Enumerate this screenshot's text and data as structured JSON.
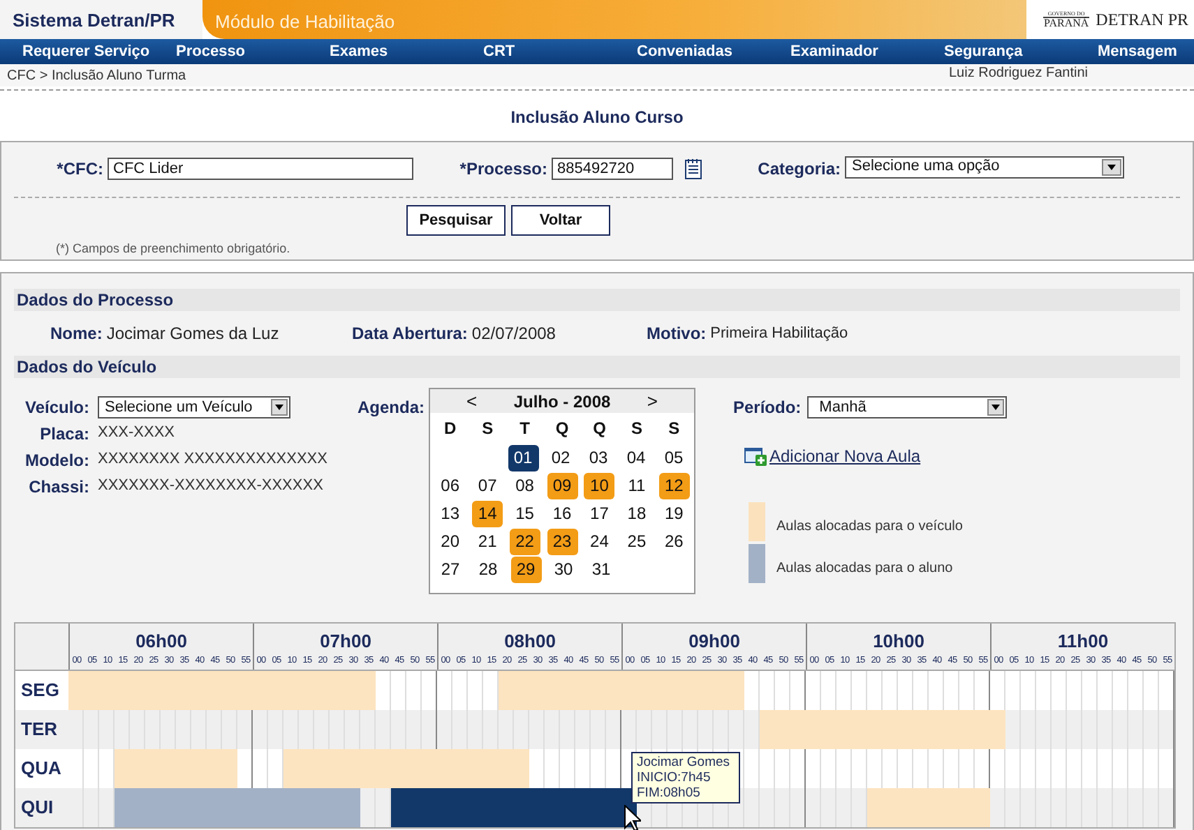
{
  "header": {
    "system_title": "Sistema Detran/PR",
    "module_title": "Módulo de Habilitação",
    "logo_top": "GOVERNO DO",
    "logo_bottom": "PARANÁ",
    "logo_right": "DETRAN PR"
  },
  "menu": [
    "Requerer Serviço",
    "Processo",
    "Exames",
    "CRT",
    "Conveniadas",
    "Examinador",
    "Segurança",
    "Mensagem"
  ],
  "breadcrumb": "CFC > Inclusão Aluno Turma",
  "user": "Luiz Rodriguez Fantini",
  "page_title": "Inclusão Aluno Curso",
  "search_form": {
    "cfc": {
      "label": "*CFC:",
      "value": "CFC Lider"
    },
    "processo": {
      "label": "*Processo:",
      "value": "885492720"
    },
    "categoria": {
      "label": "Categoria:",
      "value": "Selecione uma opção"
    },
    "buttons": [
      "Pesquisar",
      "Voltar"
    ],
    "note": "(*) Campos de preenchimento obrigatório."
  },
  "process_data": {
    "title": "Dados do Processo",
    "fields": [
      {
        "label": "Nome:",
        "value": "Jocimar Gomes da Luz"
      },
      {
        "label": "Data Abertura:",
        "value": "02/07/2008"
      },
      {
        "label": "Motivo:",
        "value": "Primeira Habilitação"
      }
    ]
  },
  "vehicle_data": {
    "title": "Dados do Veículo",
    "vehicle": {
      "label": "Veículo:",
      "value": "Selecione um Veículo"
    },
    "details": [
      {
        "label": "Placa:",
        "value": "XXX-XXXX"
      },
      {
        "label": "Modelo:",
        "value": "XXXXXXXX XXXXXXXXXXXXXX"
      },
      {
        "label": "Chassi:",
        "value": "XXXXXXX-XXXXXXXX-XXXXXX"
      }
    ],
    "agenda_label": "Agenda:",
    "period": {
      "label": "Período:",
      "value": "Manhã"
    },
    "add_link": "Adicionar Nova Aula",
    "legend": [
      {
        "label": "Aulas alocadas para o veículo",
        "color": "#fbe2bd"
      },
      {
        "label": "Aulas alocadas para o aluno",
        "color": "#a2b1c6"
      }
    ]
  },
  "calendar": {
    "prev": "<",
    "title": "Julho - 2008",
    "next": ">",
    "weekdays": [
      "D",
      "S",
      "T",
      "Q",
      "Q",
      "S",
      "S"
    ],
    "weeks": [
      {
        "days": [
          {
            "day": "01",
            "selected": true,
            "scheduled": false
          },
          {
            "day": "02",
            "selected": false,
            "scheduled": false
          },
          {
            "day": "03",
            "selected": false,
            "scheduled": false
          },
          {
            "day": "04",
            "selected": false,
            "scheduled": false
          },
          {
            "day": "05",
            "selected": false,
            "scheduled": false
          }
        ]
      },
      {
        "days": [
          {
            "day": "06",
            "selected": false,
            "scheduled": false
          },
          {
            "day": "07",
            "selected": false,
            "scheduled": false
          },
          {
            "day": "08",
            "selected": false,
            "scheduled": false
          },
          {
            "day": "09",
            "selected": false,
            "scheduled": true
          },
          {
            "day": "10",
            "selected": false,
            "scheduled": true
          },
          {
            "day": "11",
            "selected": false,
            "scheduled": false
          },
          {
            "day": "12",
            "selected": false,
            "scheduled": true
          }
        ]
      },
      {
        "days": [
          {
            "day": "13",
            "selected": false,
            "scheduled": false
          },
          {
            "day": "14",
            "selected": false,
            "scheduled": true
          },
          {
            "day": "15",
            "selected": false,
            "scheduled": false
          },
          {
            "day": "16",
            "selected": false,
            "scheduled": false
          },
          {
            "day": "17",
            "selected": false,
            "scheduled": false
          },
          {
            "day": "18",
            "selected": false,
            "scheduled": false
          },
          {
            "day": "19",
            "selected": false,
            "scheduled": false
          }
        ]
      },
      {
        "days": [
          {
            "day": "20",
            "selected": false,
            "scheduled": false
          },
          {
            "day": "21",
            "selected": false,
            "scheduled": false
          },
          {
            "day": "22",
            "selected": false,
            "scheduled": true
          },
          {
            "day": "23",
            "selected": false,
            "scheduled": true
          },
          {
            "day": "24",
            "selected": false,
            "scheduled": false
          },
          {
            "day": "25",
            "selected": false,
            "scheduled": false
          },
          {
            "day": "26",
            "selected": false,
            "scheduled": false
          }
        ]
      },
      {
        "days": [
          {
            "day": "27",
            "selected": false,
            "scheduled": false
          },
          {
            "day": "28",
            "selected": false,
            "scheduled": false
          },
          {
            "day": "29",
            "selected": false,
            "scheduled": true
          },
          {
            "day": "30",
            "selected": false,
            "scheduled": false
          },
          {
            "day": "31",
            "selected": false,
            "scheduled": false
          }
        ]
      }
    ]
  },
  "schedule": {
    "hours": [
      {
        "label": "06h00",
        "minutes": [
          "00",
          "05",
          "10",
          "15",
          "20",
          "25",
          "30",
          "35",
          "40",
          "45",
          "50",
          "55"
        ]
      },
      {
        "label": "07h00",
        "minutes": [
          "00",
          "05",
          "10",
          "15",
          "20",
          "25",
          "30",
          "35",
          "40",
          "45",
          "50",
          "55"
        ]
      },
      {
        "label": "08h00",
        "minutes": [
          "00",
          "05",
          "10",
          "15",
          "20",
          "25",
          "30",
          "35",
          "40",
          "45",
          "50",
          "55"
        ]
      },
      {
        "label": "09h00",
        "minutes": [
          "00",
          "05",
          "10",
          "15",
          "20",
          "25",
          "30",
          "35",
          "40",
          "45",
          "50",
          "55"
        ]
      },
      {
        "label": "10h00",
        "minutes": [
          "00",
          "05",
          "10",
          "15",
          "20",
          "25",
          "30",
          "35",
          "40",
          "45",
          "50",
          "55"
        ]
      },
      {
        "label": "11h00",
        "minutes": [
          "00",
          "05",
          "10",
          "15",
          "20",
          "25",
          "30",
          "35",
          "40",
          "45",
          "50",
          "55"
        ]
      }
    ],
    "rows": [
      {
        "day": "SEG",
        "slots": [
          {
            "kind": "vehicle"
          },
          {
            "kind": "vehicle"
          },
          {
            "kind": "vehicle"
          },
          {
            "kind": "vehicle"
          },
          {
            "kind": "vehicle"
          },
          {
            "kind": "vehicle"
          },
          {
            "kind": "vehicle"
          },
          {
            "kind": "vehicle"
          },
          {
            "kind": "vehicle"
          },
          {
            "kind": "vehicle"
          },
          {
            "kind": "vehicle"
          },
          {
            "kind": "vehicle"
          },
          {
            "kind": "vehicle"
          },
          {
            "kind": "vehicle"
          },
          {
            "kind": "vehicle"
          },
          {
            "kind": "vehicle"
          },
          {
            "kind": "vehicle"
          },
          {
            "kind": "vehicle"
          },
          {
            "kind": "vehicle"
          },
          {
            "kind": "vehicle"
          },
          {
            "kind": "free"
          },
          {
            "kind": "free"
          },
          {
            "kind": "free"
          },
          {
            "kind": "free"
          },
          {
            "kind": "free"
          },
          {
            "kind": "free"
          },
          {
            "kind": "free"
          },
          {
            "kind": "free"
          },
          {
            "kind": "vehicle"
          },
          {
            "kind": "vehicle"
          },
          {
            "kind": "vehicle"
          },
          {
            "kind": "vehicle"
          },
          {
            "kind": "vehicle"
          },
          {
            "kind": "vehicle"
          },
          {
            "kind": "vehicle"
          },
          {
            "kind": "vehicle"
          },
          {
            "kind": "vehicle"
          },
          {
            "kind": "vehicle"
          },
          {
            "kind": "vehicle"
          },
          {
            "kind": "vehicle"
          },
          {
            "kind": "vehicle"
          },
          {
            "kind": "vehicle"
          },
          {
            "kind": "vehicle"
          },
          {
            "kind": "vehicle"
          },
          {
            "kind": "free"
          },
          {
            "kind": "free"
          },
          {
            "kind": "free"
          },
          {
            "kind": "free"
          },
          {
            "kind": "free"
          },
          {
            "kind": "free"
          },
          {
            "kind": "free"
          },
          {
            "kind": "free"
          },
          {
            "kind": "free"
          },
          {
            "kind": "free"
          },
          {
            "kind": "free"
          },
          {
            "kind": "free"
          },
          {
            "kind": "free"
          },
          {
            "kind": "free"
          },
          {
            "kind": "free"
          },
          {
            "kind": "free"
          },
          {
            "kind": "free"
          },
          {
            "kind": "free"
          },
          {
            "kind": "free"
          },
          {
            "kind": "free"
          },
          {
            "kind": "free"
          },
          {
            "kind": "free"
          },
          {
            "kind": "free"
          },
          {
            "kind": "free"
          },
          {
            "kind": "free"
          },
          {
            "kind": "free"
          },
          {
            "kind": "free"
          },
          {
            "kind": "free"
          }
        ]
      },
      {
        "day": "TER",
        "slots": [
          {
            "kind": "free"
          },
          {
            "kind": "free"
          },
          {
            "kind": "free"
          },
          {
            "kind": "free"
          },
          {
            "kind": "free"
          },
          {
            "kind": "free"
          },
          {
            "kind": "free"
          },
          {
            "kind": "free"
          },
          {
            "kind": "free"
          },
          {
            "kind": "free"
          },
          {
            "kind": "free"
          },
          {
            "kind": "free"
          },
          {
            "kind": "free"
          },
          {
            "kind": "free"
          },
          {
            "kind": "free"
          },
          {
            "kind": "free"
          },
          {
            "kind": "free"
          },
          {
            "kind": "free"
          },
          {
            "kind": "free"
          },
          {
            "kind": "free"
          },
          {
            "kind": "free"
          },
          {
            "kind": "free"
          },
          {
            "kind": "free"
          },
          {
            "kind": "free"
          },
          {
            "kind": "free"
          },
          {
            "kind": "free"
          },
          {
            "kind": "free"
          },
          {
            "kind": "free"
          },
          {
            "kind": "free"
          },
          {
            "kind": "free"
          },
          {
            "kind": "free"
          },
          {
            "kind": "free"
          },
          {
            "kind": "free"
          },
          {
            "kind": "free"
          },
          {
            "kind": "free"
          },
          {
            "kind": "free"
          },
          {
            "kind": "free"
          },
          {
            "kind": "free"
          },
          {
            "kind": "free"
          },
          {
            "kind": "free"
          },
          {
            "kind": "free"
          },
          {
            "kind": "free"
          },
          {
            "kind": "free"
          },
          {
            "kind": "free"
          },
          {
            "kind": "free"
          },
          {
            "kind": "vehicle"
          },
          {
            "kind": "vehicle"
          },
          {
            "kind": "vehicle"
          },
          {
            "kind": "vehicle"
          },
          {
            "kind": "vehicle"
          },
          {
            "kind": "vehicle"
          },
          {
            "kind": "vehicle"
          },
          {
            "kind": "vehicle"
          },
          {
            "kind": "vehicle"
          },
          {
            "kind": "vehicle"
          },
          {
            "kind": "vehicle"
          },
          {
            "kind": "vehicle"
          },
          {
            "kind": "vehicle"
          },
          {
            "kind": "vehicle"
          },
          {
            "kind": "vehicle"
          },
          {
            "kind": "vehicle"
          },
          {
            "kind": "free"
          },
          {
            "kind": "free"
          },
          {
            "kind": "free"
          },
          {
            "kind": "free"
          },
          {
            "kind": "free"
          },
          {
            "kind": "free"
          },
          {
            "kind": "free"
          },
          {
            "kind": "free"
          },
          {
            "kind": "free"
          },
          {
            "kind": "free"
          },
          {
            "kind": "free"
          }
        ]
      },
      {
        "day": "QUA",
        "slots": [
          {
            "kind": "free"
          },
          {
            "kind": "free"
          },
          {
            "kind": "free"
          },
          {
            "kind": "vehicle"
          },
          {
            "kind": "vehicle"
          },
          {
            "kind": "vehicle"
          },
          {
            "kind": "vehicle"
          },
          {
            "kind": "vehicle"
          },
          {
            "kind": "vehicle"
          },
          {
            "kind": "vehicle"
          },
          {
            "kind": "vehicle"
          },
          {
            "kind": "free"
          },
          {
            "kind": "free"
          },
          {
            "kind": "free"
          },
          {
            "kind": "vehicle"
          },
          {
            "kind": "vehicle"
          },
          {
            "kind": "vehicle"
          },
          {
            "kind": "vehicle"
          },
          {
            "kind": "vehicle"
          },
          {
            "kind": "vehicle"
          },
          {
            "kind": "vehicle"
          },
          {
            "kind": "vehicle"
          },
          {
            "kind": "vehicle"
          },
          {
            "kind": "vehicle"
          },
          {
            "kind": "vehicle"
          },
          {
            "kind": "vehicle"
          },
          {
            "kind": "vehicle"
          },
          {
            "kind": "vehicle"
          },
          {
            "kind": "vehicle"
          },
          {
            "kind": "vehicle"
          },
          {
            "kind": "free"
          },
          {
            "kind": "free"
          },
          {
            "kind": "free"
          },
          {
            "kind": "free"
          },
          {
            "kind": "free"
          },
          {
            "kind": "free"
          },
          {
            "kind": "free"
          },
          {
            "kind": "free"
          },
          {
            "kind": "free"
          },
          {
            "kind": "free"
          },
          {
            "kind": "free"
          },
          {
            "kind": "free"
          },
          {
            "kind": "free"
          },
          {
            "kind": "free"
          },
          {
            "kind": "free"
          },
          {
            "kind": "free"
          },
          {
            "kind": "free"
          },
          {
            "kind": "free"
          },
          {
            "kind": "free"
          },
          {
            "kind": "free"
          },
          {
            "kind": "free"
          },
          {
            "kind": "free"
          },
          {
            "kind": "free"
          },
          {
            "kind": "free"
          },
          {
            "kind": "free"
          },
          {
            "kind": "free"
          },
          {
            "kind": "free"
          },
          {
            "kind": "free"
          },
          {
            "kind": "free"
          },
          {
            "kind": "free"
          },
          {
            "kind": "free"
          },
          {
            "kind": "free"
          },
          {
            "kind": "free"
          },
          {
            "kind": "free"
          },
          {
            "kind": "free"
          },
          {
            "kind": "free"
          },
          {
            "kind": "free"
          },
          {
            "kind": "free"
          },
          {
            "kind": "free"
          },
          {
            "kind": "free"
          },
          {
            "kind": "free"
          },
          {
            "kind": "free"
          }
        ]
      },
      {
        "day": "QUI",
        "slots": [
          {
            "kind": "free"
          },
          {
            "kind": "free"
          },
          {
            "kind": "free"
          },
          {
            "kind": "student"
          },
          {
            "kind": "student"
          },
          {
            "kind": "student"
          },
          {
            "kind": "student"
          },
          {
            "kind": "student"
          },
          {
            "kind": "student"
          },
          {
            "kind": "student"
          },
          {
            "kind": "student"
          },
          {
            "kind": "student"
          },
          {
            "kind": "student"
          },
          {
            "kind": "student"
          },
          {
            "kind": "student"
          },
          {
            "kind": "student"
          },
          {
            "kind": "student"
          },
          {
            "kind": "student"
          },
          {
            "kind": "student"
          },
          {
            "kind": "free"
          },
          {
            "kind": "free"
          },
          {
            "kind": "selected"
          },
          {
            "kind": "selected"
          },
          {
            "kind": "selected"
          },
          {
            "kind": "selected"
          },
          {
            "kind": "selected"
          },
          {
            "kind": "selected"
          },
          {
            "kind": "selected"
          },
          {
            "kind": "selected"
          },
          {
            "kind": "selected"
          },
          {
            "kind": "selected"
          },
          {
            "kind": "selected"
          },
          {
            "kind": "selected"
          },
          {
            "kind": "selected"
          },
          {
            "kind": "selected"
          },
          {
            "kind": "selected"
          },
          {
            "kind": "selected"
          },
          {
            "kind": "free"
          },
          {
            "kind": "free"
          },
          {
            "kind": "free"
          },
          {
            "kind": "free"
          },
          {
            "kind": "free"
          },
          {
            "kind": "free"
          },
          {
            "kind": "free"
          },
          {
            "kind": "free"
          },
          {
            "kind": "free"
          },
          {
            "kind": "free"
          },
          {
            "kind": "free"
          },
          {
            "kind": "free"
          },
          {
            "kind": "free"
          },
          {
            "kind": "free"
          },
          {
            "kind": "free"
          },
          {
            "kind": "vehicle"
          },
          {
            "kind": "vehicle"
          },
          {
            "kind": "vehicle"
          },
          {
            "kind": "vehicle"
          },
          {
            "kind": "vehicle"
          },
          {
            "kind": "vehicle"
          },
          {
            "kind": "vehicle"
          },
          {
            "kind": "vehicle"
          },
          {
            "kind": "free"
          },
          {
            "kind": "free"
          },
          {
            "kind": "free"
          },
          {
            "kind": "free"
          },
          {
            "kind": "free"
          },
          {
            "kind": "free"
          },
          {
            "kind": "free"
          },
          {
            "kind": "free"
          },
          {
            "kind": "free"
          },
          {
            "kind": "free"
          },
          {
            "kind": "free"
          },
          {
            "kind": "free"
          }
        ]
      }
    ],
    "tooltip": {
      "lines": [
        "Jocimar Gomes",
        "INICIO:7h45",
        "FIM:08h05"
      ]
    }
  }
}
